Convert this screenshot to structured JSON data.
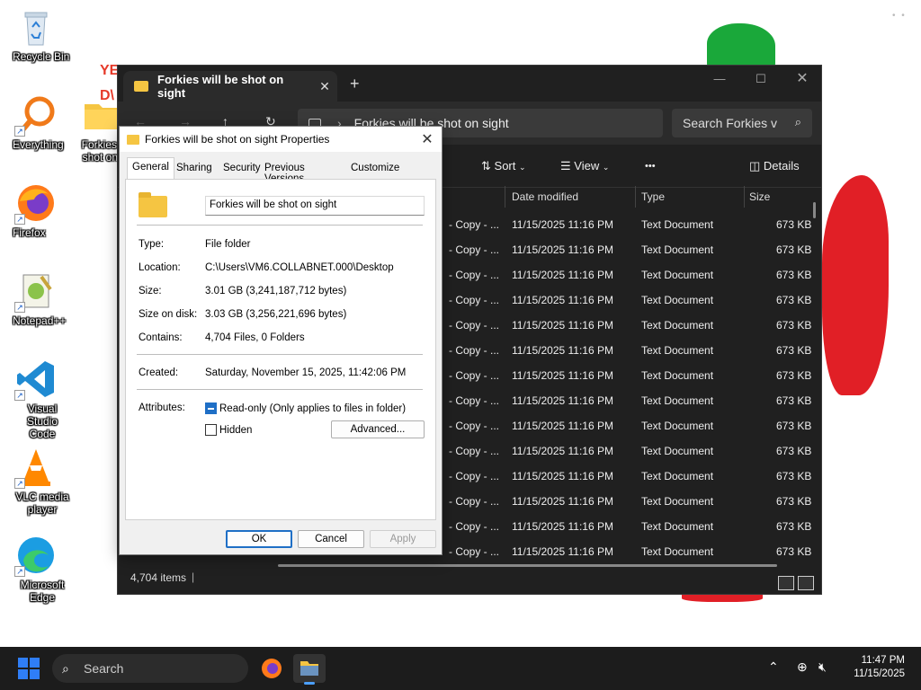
{
  "desktop": {
    "icons": [
      {
        "label": "Recycle Bin",
        "icon": "recycle-bin-icon"
      },
      {
        "label": "Everything",
        "icon": "everything-search-icon"
      },
      {
        "label": "Firefox",
        "icon": "firefox-icon"
      },
      {
        "label": "Notepad++",
        "icon": "notepad-plus-plus-icon"
      },
      {
        "label": "Visual Studio Code",
        "icon": "vscode-icon"
      },
      {
        "label": "VLC media player",
        "icon": "vlc-icon"
      },
      {
        "label": "Microsoft Edge",
        "icon": "edge-icon"
      },
      {
        "label": "Forkies w... shot on s...",
        "icon": "folder-icon"
      }
    ],
    "stray_text_1": "YE",
    "stray_text_2": "D\\"
  },
  "explorer": {
    "tab_title": "Forkies will be shot on sight",
    "new_tab": "+",
    "address": "Forkies will be shot on sight",
    "search_placeholder": "Search Forkies v",
    "commands": {
      "sort": "Sort",
      "view": "View",
      "more": "•••",
      "details": "Details"
    },
    "columns": {
      "date": "Date modified",
      "type": "Type",
      "size": "Size"
    },
    "rows": [
      {
        "name": "- Copy - ...",
        "date": "11/15/2025 11:16 PM",
        "type": "Text Document",
        "size": "673 KB"
      },
      {
        "name": "- Copy - ...",
        "date": "11/15/2025 11:16 PM",
        "type": "Text Document",
        "size": "673 KB"
      },
      {
        "name": "- Copy - ...",
        "date": "11/15/2025 11:16 PM",
        "type": "Text Document",
        "size": "673 KB"
      },
      {
        "name": "- Copy - ...",
        "date": "11/15/2025 11:16 PM",
        "type": "Text Document",
        "size": "673 KB"
      },
      {
        "name": "- Copy - ...",
        "date": "11/15/2025 11:16 PM",
        "type": "Text Document",
        "size": "673 KB"
      },
      {
        "name": "- Copy - ...",
        "date": "11/15/2025 11:16 PM",
        "type": "Text Document",
        "size": "673 KB"
      },
      {
        "name": "- Copy - ...",
        "date": "11/15/2025 11:16 PM",
        "type": "Text Document",
        "size": "673 KB"
      },
      {
        "name": "- Copy - ...",
        "date": "11/15/2025 11:16 PM",
        "type": "Text Document",
        "size": "673 KB"
      },
      {
        "name": "- Copy - ...",
        "date": "11/15/2025 11:16 PM",
        "type": "Text Document",
        "size": "673 KB"
      },
      {
        "name": "- Copy - ...",
        "date": "11/15/2025 11:16 PM",
        "type": "Text Document",
        "size": "673 KB"
      },
      {
        "name": "- Copy - ...",
        "date": "11/15/2025 11:16 PM",
        "type": "Text Document",
        "size": "673 KB"
      },
      {
        "name": "- Copy - ...",
        "date": "11/15/2025 11:16 PM",
        "type": "Text Document",
        "size": "673 KB"
      },
      {
        "name": "- Copy - ...",
        "date": "11/15/2025 11:16 PM",
        "type": "Text Document",
        "size": "673 KB"
      },
      {
        "name": "- Copy - ...",
        "date": "11/15/2025 11:16 PM",
        "type": "Text Document",
        "size": "673 KB"
      }
    ],
    "status": "4,704 items",
    "status_sep": "|"
  },
  "properties": {
    "title": "Forkies will be shot on sight Properties",
    "tabs": [
      "General",
      "Sharing",
      "Security",
      "Previous Versions",
      "Customize"
    ],
    "folder_name": "Forkies will be shot on sight",
    "type_label": "Type:",
    "type_value": "File folder",
    "location_label": "Location:",
    "location_value": "C:\\Users\\VM6.COLLABNET.000\\Desktop",
    "size_label": "Size:",
    "size_value": "3.01 GB (3,241,187,712 bytes)",
    "size_disk_label": "Size on disk:",
    "size_disk_value": "3.03 GB (3,256,221,696 bytes)",
    "contains_label": "Contains:",
    "contains_value": "4,704 Files, 0 Folders",
    "created_label": "Created:",
    "created_value": "Saturday, November 15, 2025, 11:42:06 PM",
    "attributes_label": "Attributes:",
    "readonly_label": "Read-only (Only applies to files in folder)",
    "hidden_label": "Hidden",
    "advanced_button": "Advanced...",
    "ok_button": "OK",
    "cancel_button": "Cancel",
    "apply_button": "Apply"
  },
  "taskbar": {
    "search_label": "Search",
    "time": "11:47 PM",
    "date": "11/15/2025"
  },
  "colors": {
    "accent": "#1f6fc6",
    "explorer_bg": "#202020",
    "folder": "#f5c542"
  }
}
